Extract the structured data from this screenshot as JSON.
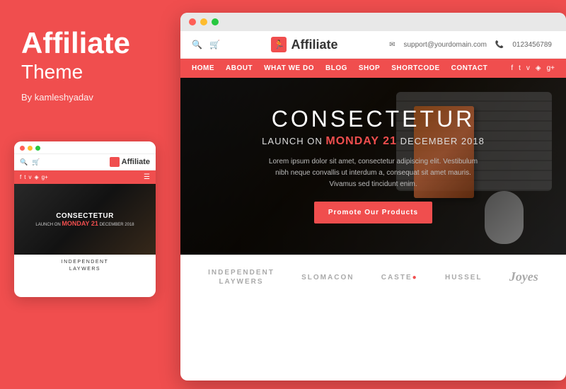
{
  "brand": {
    "title": "Affiliate",
    "subtitle": "Theme",
    "author": "By kamleshyadav"
  },
  "mobile": {
    "hero": {
      "pre": "CONSECTETUR",
      "launch_label": "LAUNCH ON",
      "day": "MONDAY 21",
      "date_suffix": "DECEMBER 2018"
    },
    "footer": {
      "line1": "INDEPENDENT",
      "line2": "LAYWERS"
    },
    "logo_text": "Affiliate"
  },
  "desktop": {
    "logo_text": "Affiliate",
    "header": {
      "support_email": "support@yourdomain.com",
      "phone": "0123456789"
    },
    "nav": {
      "links": [
        "HOME",
        "ABOUT",
        "WHAT WE DO",
        "BLOG",
        "SHOP",
        "SHORTCODE",
        "CONTACT"
      ]
    },
    "hero": {
      "title": "CONSECTETUR",
      "subtitle_pre": "LAUNCH ON",
      "day_highlight": "MONDAY 21",
      "date_suffix": "DECEMBER 2018",
      "description": "Lorem ipsum dolor sit amet, consectetur adipiscing elit. Vestibulum nibh neque convallis ut interdum a, consequat sit amet mauris. Vivamus sed tincidunt enim.",
      "cta_button": "Promote Our Products"
    },
    "brands": [
      {
        "name": "INDEPENDENT\nLAYWERS",
        "style": "normal"
      },
      {
        "name": "SLOMACON",
        "style": "normal"
      },
      {
        "name": "CASTE●",
        "style": "normal"
      },
      {
        "name": "HUSSEL",
        "style": "normal"
      },
      {
        "name": "Joyes",
        "style": "script"
      }
    ]
  },
  "colors": {
    "brand_red": "#f04e4e",
    "dark_bg": "#1a1a1a",
    "white": "#ffffff"
  }
}
